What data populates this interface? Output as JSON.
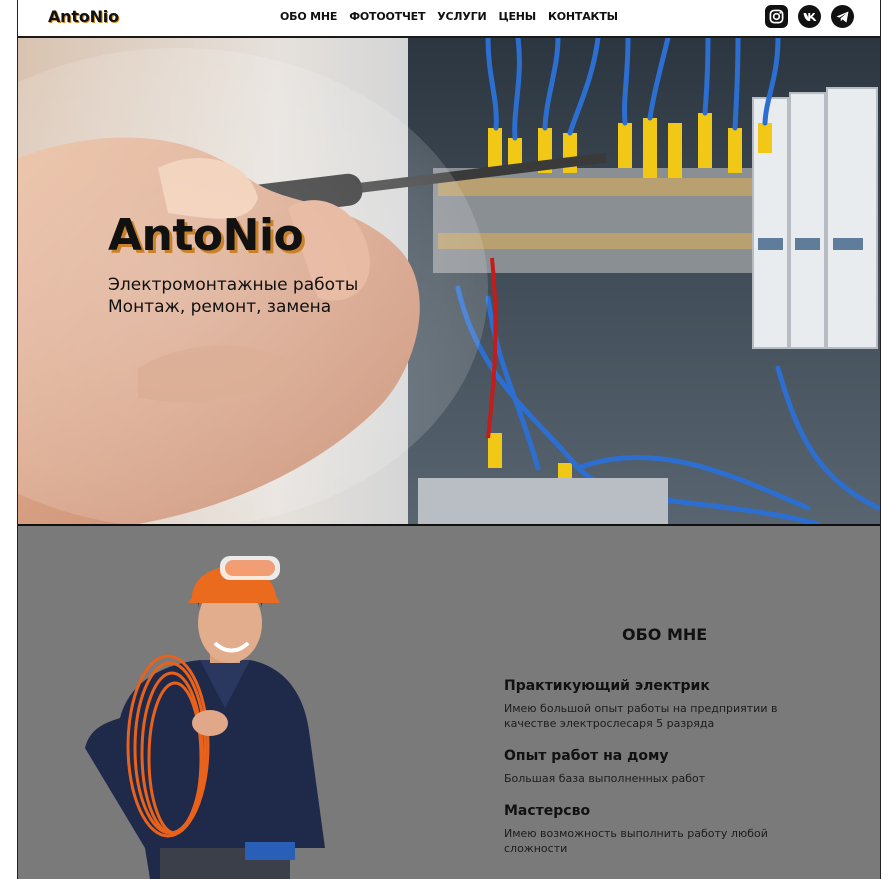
{
  "brand": {
    "logo": "AntoNio"
  },
  "nav": {
    "items": [
      "ОБО МНЕ",
      "ФОТООТЧЕТ",
      "УСЛУГИ",
      "ЦЕНЫ",
      "КОНТАКТЫ"
    ]
  },
  "socials": [
    "instagram-icon",
    "vk-icon",
    "telegram-icon"
  ],
  "hero": {
    "title": "AntoNio",
    "line1": "Электромонтажные работы",
    "line2": "Монтаж, ремонт, замена"
  },
  "about": {
    "title": "ОБО МНЕ",
    "features": [
      {
        "title": "Практикующий электрик",
        "text": "Имею большой опыт работы на предприятии в качестве электрослесаря 5 разряда"
      },
      {
        "title": "Опыт работ на дому",
        "text": "Большая база выполненных работ"
      },
      {
        "title": "Мастерсво",
        "text": "Имею возможность выполнить работу любой сложности"
      }
    ]
  },
  "colors": {
    "accent": "#c9822a",
    "about_bg": "#7a7a7a",
    "text": "#111111"
  }
}
